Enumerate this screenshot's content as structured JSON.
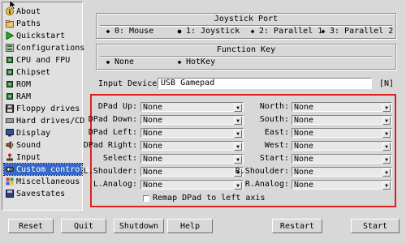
{
  "sidebar": {
    "items": [
      {
        "label": "About",
        "icon": "info-icon",
        "selected": false
      },
      {
        "label": "Paths",
        "icon": "folder-icon",
        "selected": false
      },
      {
        "label": "Quickstart",
        "icon": "play-icon",
        "selected": false
      },
      {
        "label": "Configurations",
        "icon": "config-icon",
        "selected": false
      },
      {
        "label": "CPU and FPU",
        "icon": "chip-icon",
        "selected": false
      },
      {
        "label": "Chipset",
        "icon": "chip-icon",
        "selected": false
      },
      {
        "label": "ROM",
        "icon": "chip-icon",
        "selected": false
      },
      {
        "label": "RAM",
        "icon": "chip-icon",
        "selected": false
      },
      {
        "label": "Floppy drives",
        "icon": "floppy-icon",
        "selected": false
      },
      {
        "label": "Hard drives/CD",
        "icon": "harddrive-icon",
        "selected": false
      },
      {
        "label": "Display",
        "icon": "monitor-icon",
        "selected": false
      },
      {
        "label": "Sound",
        "icon": "speaker-icon",
        "selected": false
      },
      {
        "label": "Input",
        "icon": "joystick-icon",
        "selected": false
      },
      {
        "label": "Custom controls",
        "icon": "gamepad-icon",
        "selected": true
      },
      {
        "label": "Miscellaneous",
        "icon": "misc-icon",
        "selected": false
      },
      {
        "label": "Savestates",
        "icon": "savestate-icon",
        "selected": false
      }
    ]
  },
  "joystick_port": {
    "title": "Joystick Port",
    "options": [
      "0: Mouse",
      "1: Joystick",
      "2: Parallel 1",
      "3: Parallel 2"
    ],
    "selected": "1: Joystick"
  },
  "function_key": {
    "title": "Function Key",
    "options": [
      "None",
      "HotKey"
    ],
    "selected": "None"
  },
  "input_device": {
    "label": "Input Device:",
    "value": "USB Gamepad",
    "tag": "[N]"
  },
  "controls": {
    "left": [
      {
        "label": "DPad Up:",
        "value": "None"
      },
      {
        "label": "DPad Down:",
        "value": "None"
      },
      {
        "label": "DPad Left:",
        "value": "None"
      },
      {
        "label": "DPad Right:",
        "value": "None"
      },
      {
        "label": "Select:",
        "value": "None"
      },
      {
        "label": "L.Shoulder:",
        "value": "None"
      },
      {
        "label": "L.Analog:",
        "value": "None"
      }
    ],
    "right": [
      {
        "label": "North:",
        "value": "None"
      },
      {
        "label": "South:",
        "value": "None"
      },
      {
        "label": "East:",
        "value": "None"
      },
      {
        "label": "West:",
        "value": "None"
      },
      {
        "label": "Start:",
        "value": "None"
      },
      {
        "label": "R.Shoulder:",
        "value": "None"
      },
      {
        "label": "R.Analog:",
        "value": "None"
      }
    ],
    "remap_label": "Remap DPad to left axis",
    "remap_checked": false
  },
  "buttons": {
    "reset": "Reset",
    "quit": "Quit",
    "shutdown": "Shutdown",
    "help": "Help",
    "restart": "Restart",
    "start": "Start"
  },
  "colors": {
    "selection": "#3868c8",
    "highlight_border": "#e02020",
    "background": "#d8d8d8"
  }
}
